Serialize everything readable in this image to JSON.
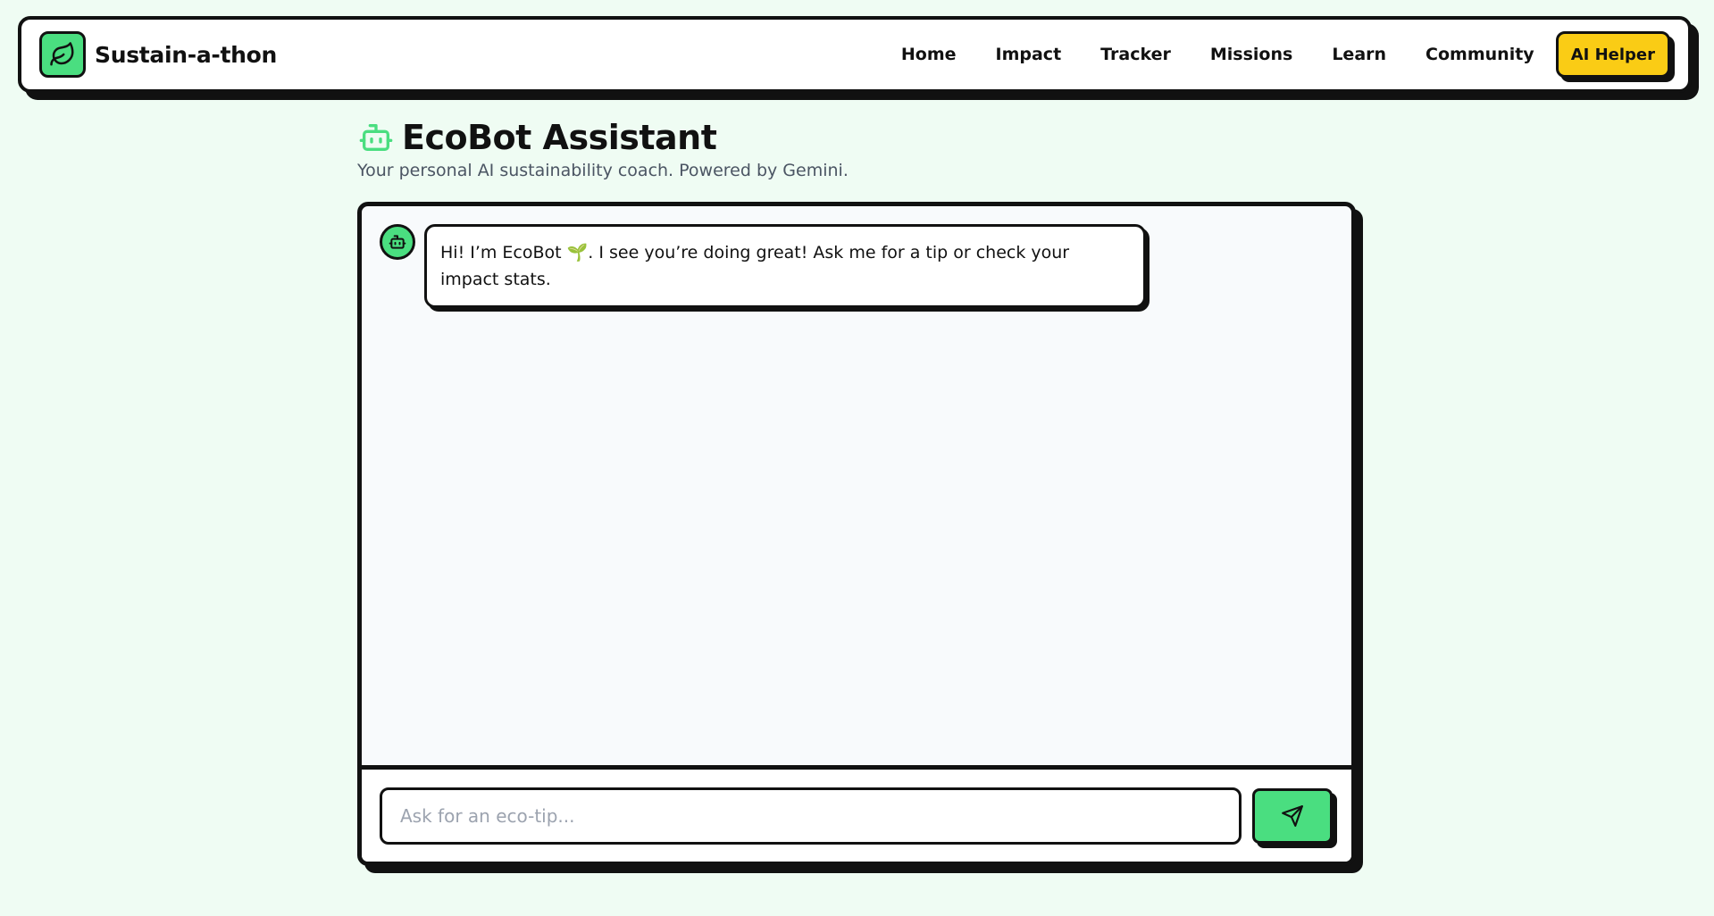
{
  "navbar": {
    "brand_name": "Sustain-a-thon",
    "brand_icon": "leaf-icon",
    "links": [
      {
        "label": "Home"
      },
      {
        "label": "Impact"
      },
      {
        "label": "Tracker"
      },
      {
        "label": "Missions"
      },
      {
        "label": "Learn"
      },
      {
        "label": "Community"
      }
    ],
    "cta_label": "AI Helper"
  },
  "page": {
    "title": "EcoBot Assistant",
    "title_icon": "robot-icon",
    "subtitle": "Your personal AI sustainability coach. Powered by Gemini."
  },
  "chat": {
    "messages": [
      {
        "sender": "bot",
        "avatar_icon": "robot-icon",
        "text": "Hi! I’m EcoBot 🌱. I see you’re doing great! Ask me for a tip or check your impact stats."
      }
    ],
    "input": {
      "value": "",
      "placeholder": "Ask for an eco-tip..."
    },
    "send_icon": "send-icon"
  },
  "colors": {
    "background": "#effcf3",
    "accent_green": "#4ade80",
    "accent_yellow": "#facc15",
    "ink": "#111111",
    "subtitle": "#4b5563"
  }
}
